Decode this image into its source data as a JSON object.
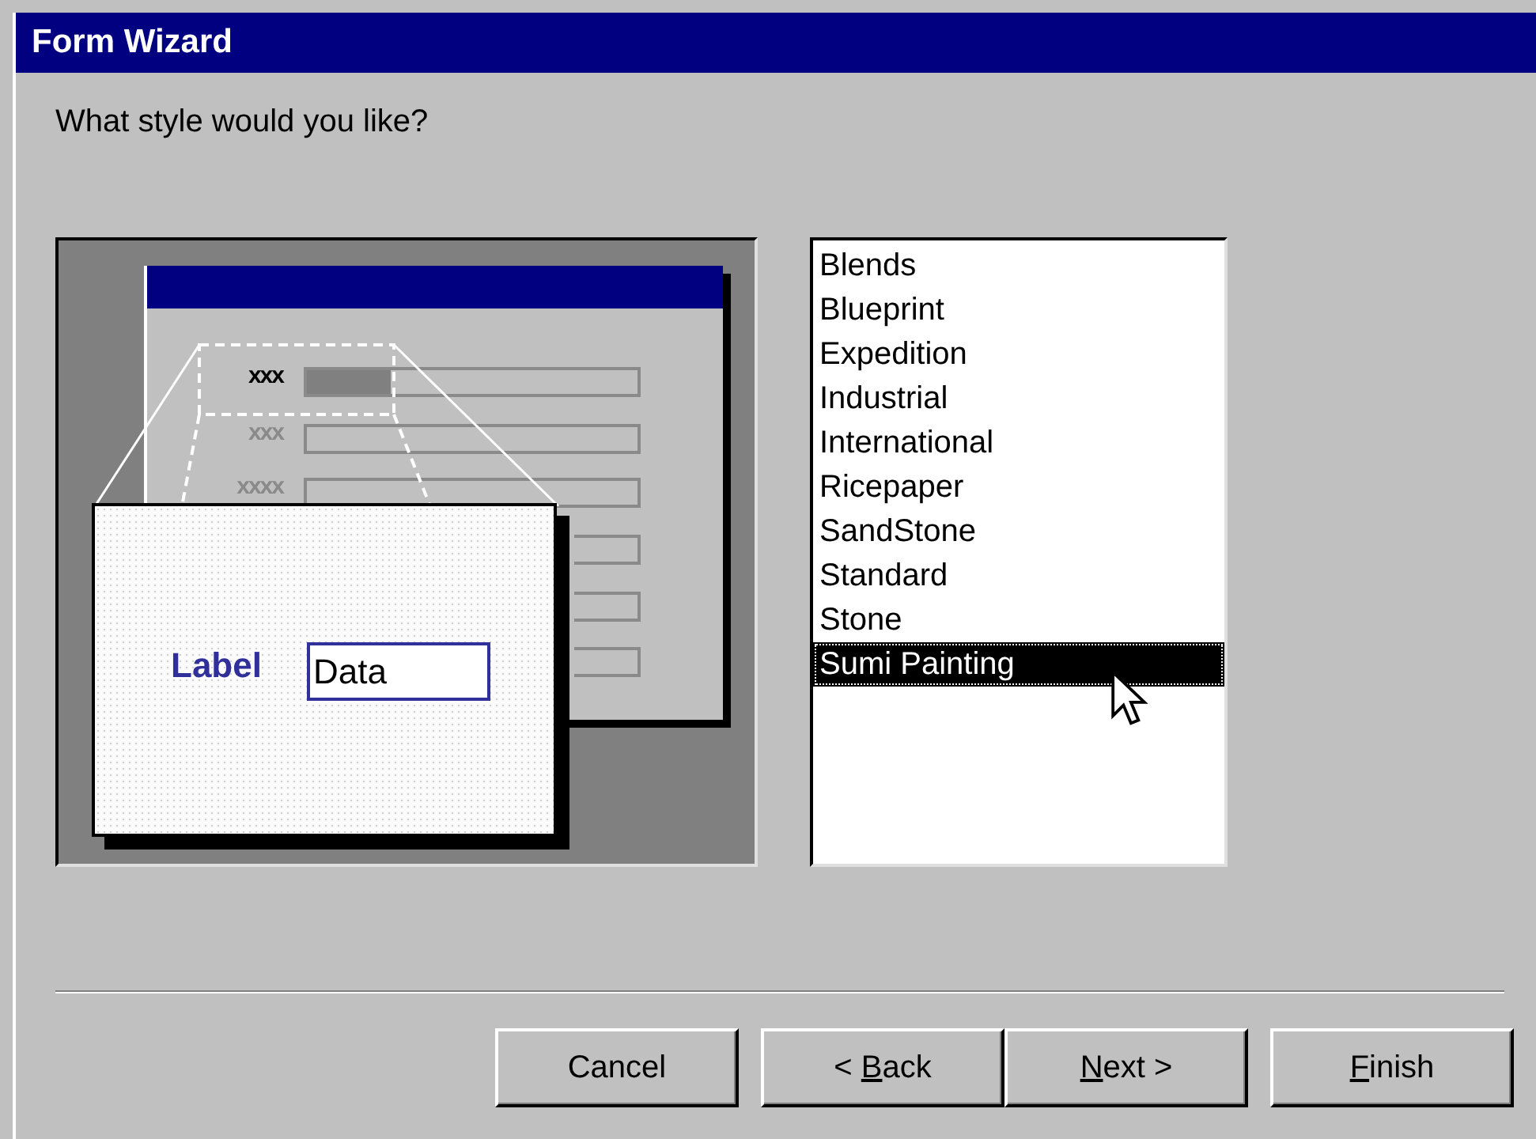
{
  "window": {
    "title": "Form Wizard"
  },
  "prompt": "What style would you like?",
  "preview": {
    "field_labels": [
      {
        "text": "xxx",
        "selected": true
      },
      {
        "text": "xxx",
        "selected": false
      },
      {
        "text": "xxxx",
        "selected": false
      }
    ],
    "zoom_label": "Label",
    "zoom_value": "Data"
  },
  "styles": [
    {
      "label": "Blends",
      "selected": false
    },
    {
      "label": "Blueprint",
      "selected": false
    },
    {
      "label": "Expedition",
      "selected": false
    },
    {
      "label": "Industrial",
      "selected": false
    },
    {
      "label": "International",
      "selected": false
    },
    {
      "label": "Ricepaper",
      "selected": false
    },
    {
      "label": "SandStone",
      "selected": false
    },
    {
      "label": "Standard",
      "selected": false
    },
    {
      "label": "Stone",
      "selected": false
    },
    {
      "label": "Sumi Painting",
      "selected": true
    }
  ],
  "buttons": [
    {
      "prefix": "Cancel"
    },
    {
      "prefix": "< ",
      "access_key": "B",
      "rest": "ack"
    },
    {
      "access_key": "N",
      "rest": "ext >"
    },
    {
      "access_key": "F",
      "rest": "inish"
    }
  ]
}
